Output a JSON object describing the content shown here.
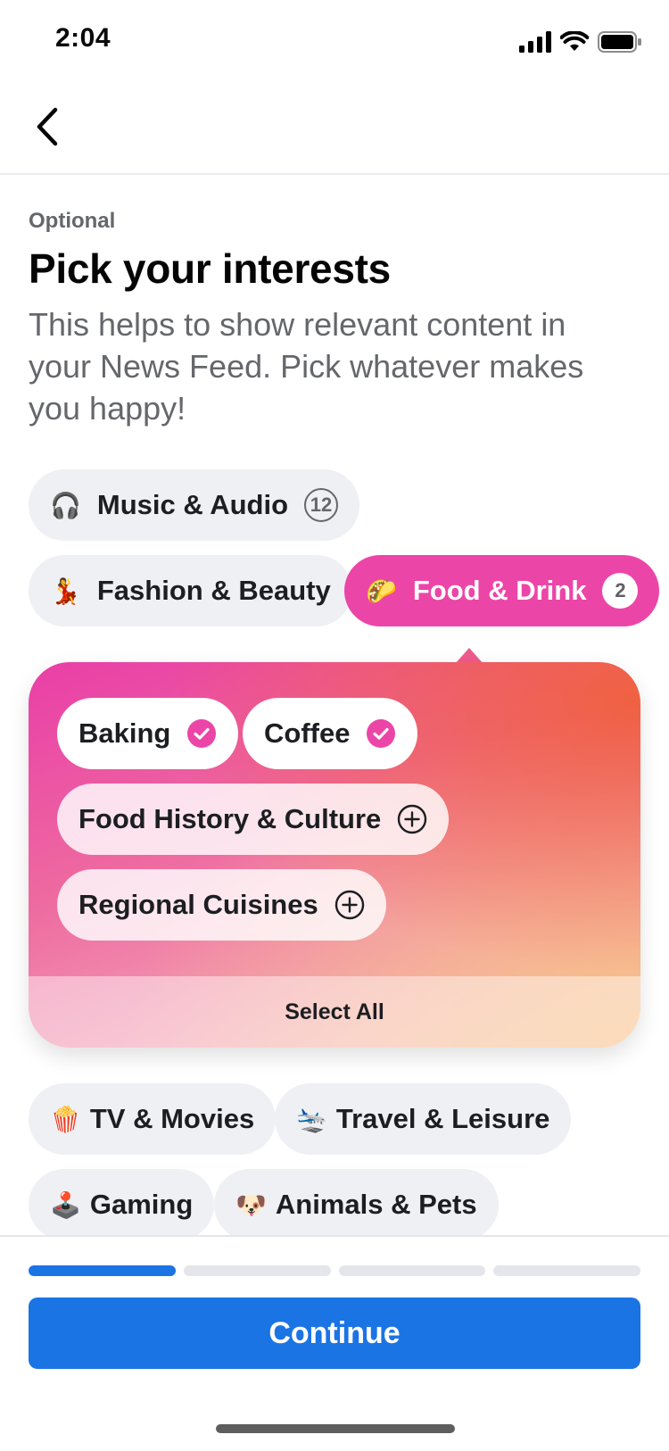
{
  "status_bar": {
    "time": "2:04"
  },
  "header": {
    "eyebrow": "Optional",
    "title": "Pick your interests",
    "subtitle": "This helps to show relevant content in your News Feed. Pick whatever makes you happy!"
  },
  "categories": {
    "music": {
      "emoji": "🎧",
      "label": "Music & Audio",
      "count": "12"
    },
    "fashion": {
      "emoji": "💃",
      "label": "Fashion & Beauty"
    },
    "food": {
      "emoji": "🌮",
      "label": "Food & Drink",
      "count": "2"
    },
    "tv": {
      "emoji": "🍿",
      "label": "TV & Movies"
    },
    "travel": {
      "emoji": "🛬",
      "label": "Travel & Leisure"
    },
    "gaming": {
      "emoji": "🕹️",
      "label": "Gaming"
    },
    "animals": {
      "emoji": "🐶",
      "label": "Animals & Pets"
    }
  },
  "food_panel": {
    "subtopics": [
      {
        "label": "Baking",
        "selected": true
      },
      {
        "label": "Coffee",
        "selected": true
      },
      {
        "label": "Food History & Culture",
        "selected": false
      },
      {
        "label": "Regional Cuisines",
        "selected": false
      }
    ],
    "select_all": "Select All"
  },
  "footer": {
    "continue_label": "Continue",
    "progress": {
      "current_step": 1,
      "total_steps": 4
    }
  },
  "colors": {
    "accent_pink": "#ec45a8",
    "primary_blue": "#1b74e4",
    "chip_bg": "#eff0f4"
  }
}
